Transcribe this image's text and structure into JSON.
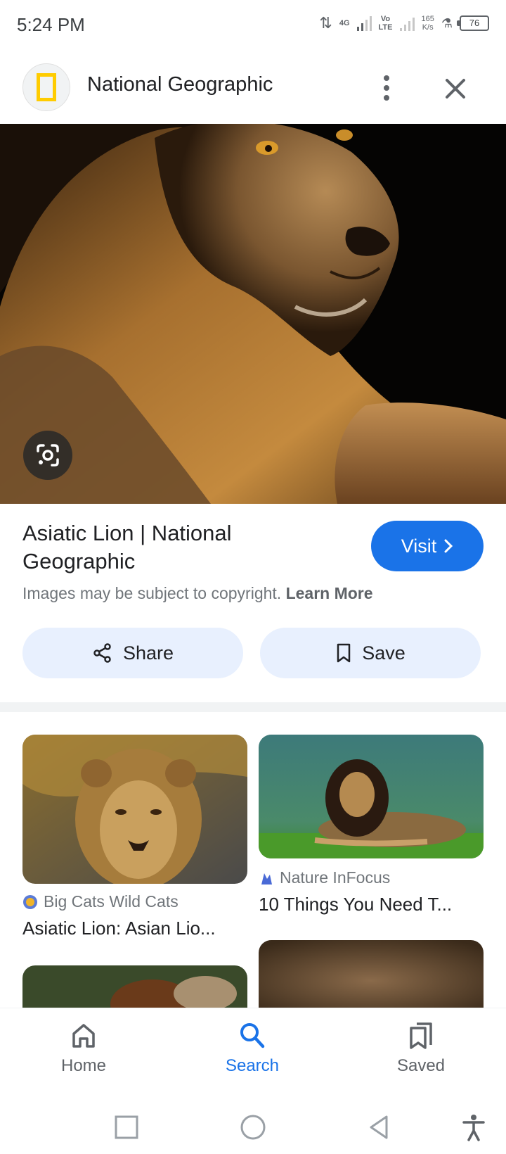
{
  "status_bar": {
    "time": "5:24 PM",
    "network_1": "4G",
    "network_2_top": "Vo",
    "network_2_bottom": "LTE",
    "speed_value": "165",
    "speed_unit": "K/s",
    "battery": "76"
  },
  "header": {
    "title": "National Geographic",
    "logo_icon": "national-geographic-logo",
    "more_icon": "more-vert-icon",
    "close_icon": "close-icon"
  },
  "hero": {
    "lens_icon": "google-lens-icon"
  },
  "result": {
    "title": "Asiatic Lion | National Geographic",
    "visit_label": "Visit",
    "copyright_text": "Images may be subject to copyright.",
    "learn_more": "Learn More",
    "share_label": "Share",
    "save_label": "Save"
  },
  "related": [
    {
      "source": "Big Cats Wild Cats",
      "caption": "Asiatic Lion: Asian Lio..."
    },
    {
      "source": "Nature InFocus",
      "caption": "10 Things You Need T..."
    }
  ],
  "bottom_nav": {
    "items": [
      {
        "label": "Home",
        "icon": "home-icon"
      },
      {
        "label": "Search",
        "icon": "search-icon",
        "active": true
      },
      {
        "label": "Saved",
        "icon": "saved-icon"
      }
    ]
  },
  "colors": {
    "accent": "#1a73e8",
    "chip_bg": "#e8f0fe",
    "ng_yellow": "#ffcc00"
  }
}
